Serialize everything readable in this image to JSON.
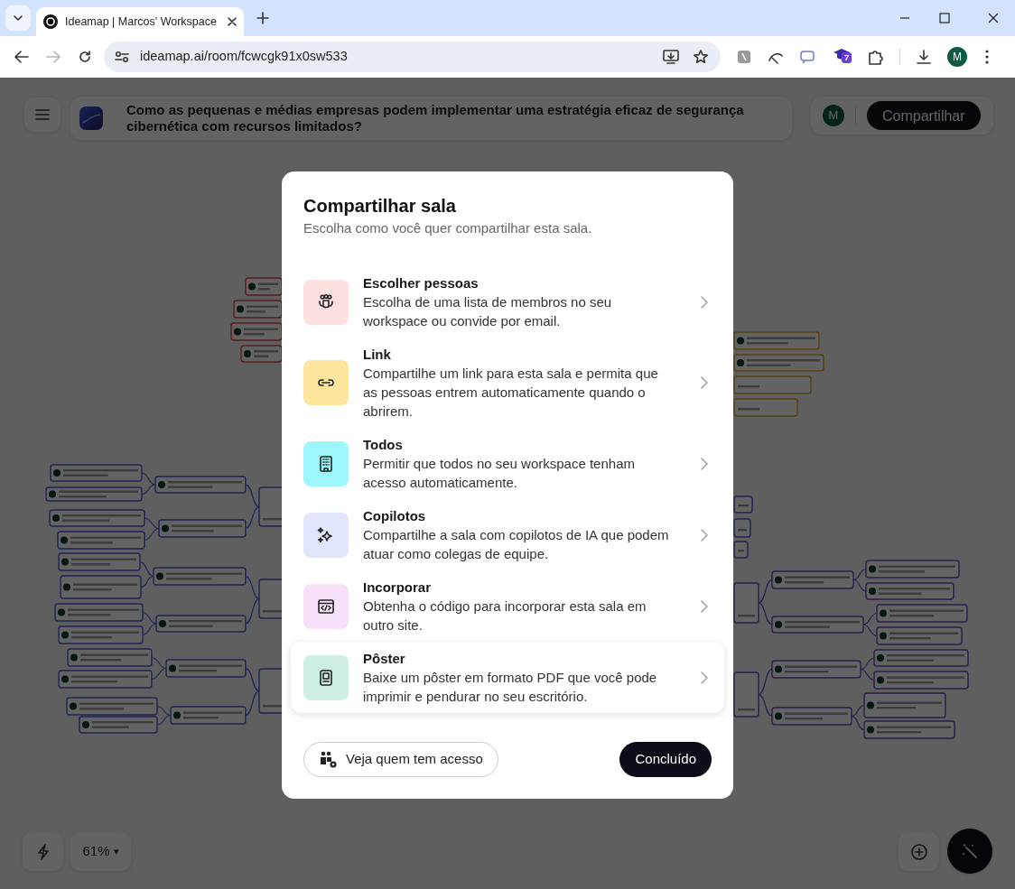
{
  "browser": {
    "tab_title": "Ideamap | Marcos' Workspace",
    "url": "ideamap.ai/room/fcwcgk91x0sw533",
    "can_go_forward": false,
    "extension_badge": "7",
    "profile_initial": "M"
  },
  "app": {
    "room_title": "Como as pequenas e médias empresas podem implementar uma estratégia eficaz de segurança cibernética com recursos limitados?",
    "avatar_initial": "M",
    "share_button": "Compartilhar",
    "zoom_level": "61%",
    "zoom_caret": "▾"
  },
  "modal": {
    "title": "Compartilhar sala",
    "subtitle": "Escolha como você quer compartilhar esta sala.",
    "options": [
      {
        "title": "Escolher pessoas",
        "description": "Escolha de uma lista de membros no seu workspace ou convide por email.",
        "color": "#fde1e1",
        "highlighted": false
      },
      {
        "title": "Link",
        "description": "Compartilhe um link para esta sala e permita que as pessoas entrem automaticamente quando o abrirem.",
        "color": "#fde59e",
        "highlighted": false
      },
      {
        "title": "Todos",
        "description": "Permitir que todos no seu workspace tenham acesso automaticamente.",
        "color": "#9df7fb",
        "highlighted": false
      },
      {
        "title": "Copilotos",
        "description": "Compartilhe a sala com copilotos de IA que podem atuar como colegas de equipe.",
        "color": "#e2e6fd",
        "highlighted": false
      },
      {
        "title": "Incorporar",
        "description": "Obtenha o código para incorporar esta sala em outro site.",
        "color": "#f6e1f9",
        "highlighted": false
      },
      {
        "title": "Pôster",
        "description": "Baixe um pôster em formato PDF que você pode imprimir e pendurar no seu escritório.",
        "color": "#cfeee2",
        "highlighted": true
      }
    ],
    "access_button": "Veja quem tem acesso",
    "done_button": "Concluído"
  }
}
